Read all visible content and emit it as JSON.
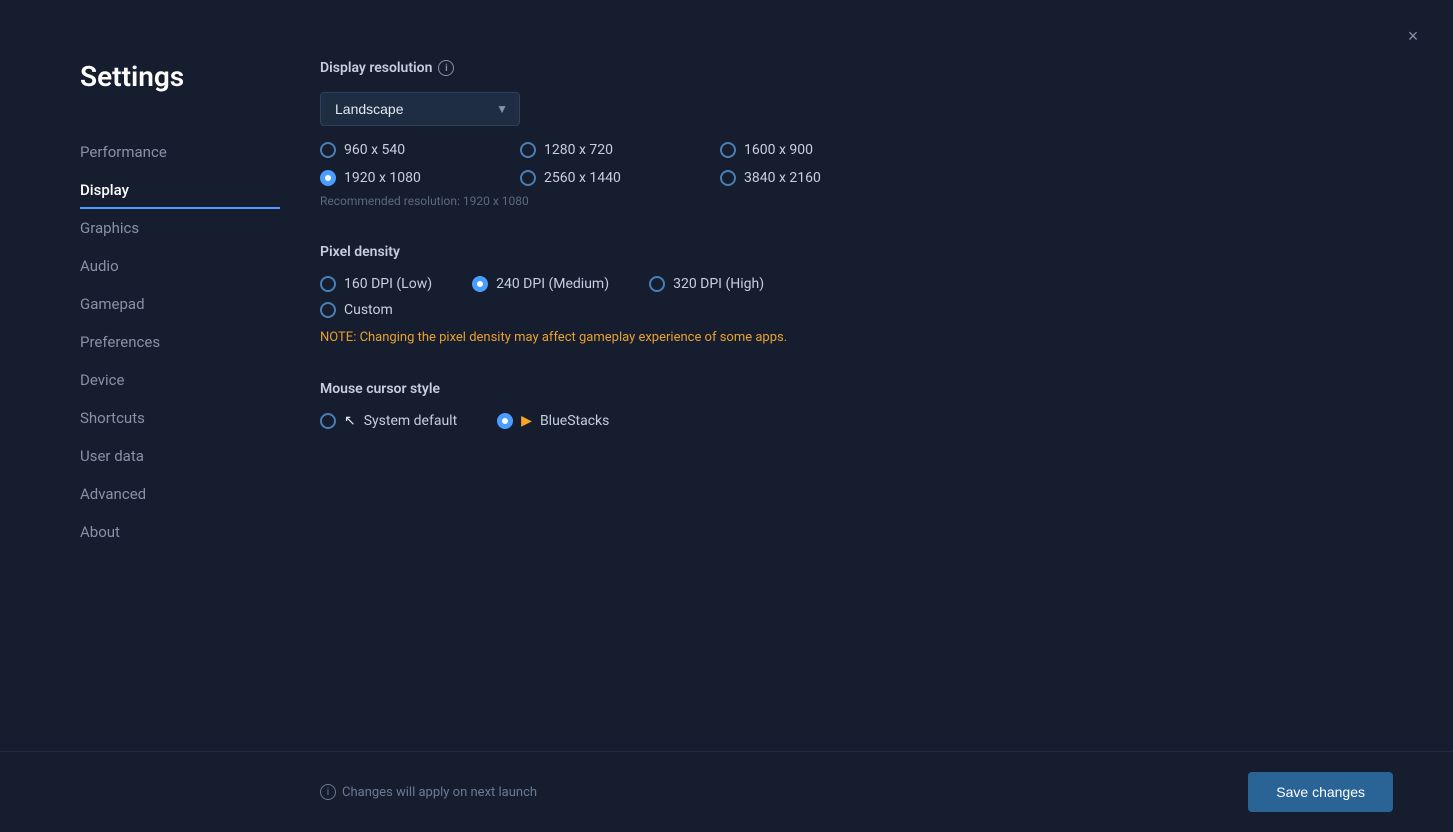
{
  "page": {
    "title": "Settings",
    "close_label": "×"
  },
  "sidebar": {
    "items": [
      {
        "id": "performance",
        "label": "Performance",
        "active": false
      },
      {
        "id": "display",
        "label": "Display",
        "active": true
      },
      {
        "id": "graphics",
        "label": "Graphics",
        "active": false
      },
      {
        "id": "audio",
        "label": "Audio",
        "active": false
      },
      {
        "id": "gamepad",
        "label": "Gamepad",
        "active": false
      },
      {
        "id": "preferences",
        "label": "Preferences",
        "active": false
      },
      {
        "id": "device",
        "label": "Device",
        "active": false
      },
      {
        "id": "shortcuts",
        "label": "Shortcuts",
        "active": false
      },
      {
        "id": "user-data",
        "label": "User data",
        "active": false
      },
      {
        "id": "advanced",
        "label": "Advanced",
        "active": false
      },
      {
        "id": "about",
        "label": "About",
        "active": false
      }
    ]
  },
  "display": {
    "resolution_section": {
      "title": "Display resolution",
      "dropdown_value": "Landscape",
      "resolutions": [
        {
          "value": "960x540",
          "label": "960 x 540",
          "selected": false
        },
        {
          "value": "1280x720",
          "label": "1280 x 720",
          "selected": false
        },
        {
          "value": "1600x900",
          "label": "1600 x 900",
          "selected": false
        },
        {
          "value": "1920x1080",
          "label": "1920 x 1080",
          "selected": true
        },
        {
          "value": "2560x1440",
          "label": "2560 x 1440",
          "selected": false
        },
        {
          "value": "3840x2160",
          "label": "3840 x 2160",
          "selected": false
        }
      ],
      "recommended_text": "Recommended resolution: 1920 x 1080"
    },
    "pixel_density_section": {
      "title": "Pixel density",
      "options": [
        {
          "value": "160",
          "label": "160 DPI (Low)",
          "selected": false
        },
        {
          "value": "240",
          "label": "240 DPI (Medium)",
          "selected": true
        },
        {
          "value": "320",
          "label": "320 DPI (High)",
          "selected": false
        },
        {
          "value": "custom",
          "label": "Custom",
          "selected": false
        }
      ],
      "note": "NOTE: Changing the pixel density may affect gameplay experience of some apps."
    },
    "mouse_cursor_section": {
      "title": "Mouse cursor style",
      "options": [
        {
          "value": "system",
          "label": "System default",
          "selected": false
        },
        {
          "value": "bluestacks",
          "label": "BlueStacks",
          "selected": true
        }
      ]
    }
  },
  "footer": {
    "note": "Changes will apply on next launch",
    "save_label": "Save changes"
  }
}
